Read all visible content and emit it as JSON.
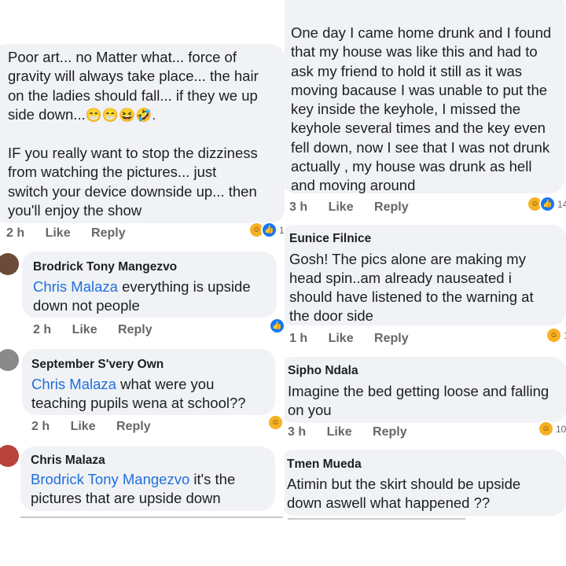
{
  "left": {
    "top_comment": {
      "lines": [
        "Poor  art... no Matter what... force of",
        "gravity will always take place... the hair",
        "on the ladies should  fall... if they we up",
        "side down...",
        "",
        "IF you really  want to  stop the dizziness",
        "from watching  the pictures... just",
        "switch your  device  downside up... then",
        "you'll  enjoy  the show"
      ],
      "emojis": "😁😁😆🤣.",
      "time": "2 h",
      "like": "Like",
      "reply": "Reply",
      "reaction_count": "1"
    },
    "comments": [
      {
        "name": "Brodrick Tony Mangezvo",
        "mention": "Chris Malaza",
        "line1_rest": " everything is upside",
        "line2": "down not people",
        "time": "2 h",
        "like": "Like",
        "reply": "Reply"
      },
      {
        "name": "September S'very Own",
        "mention": "Chris Malaza",
        "line1_rest": " what were you",
        "line2": "teaching pupils wena at school??",
        "time": "2 h",
        "like": "Like",
        "reply": "Reply"
      },
      {
        "name": "Chris Malaza",
        "mention": "Brodrick Tony Mangezvo",
        "line1_rest": " it's the",
        "line2": "pictures that are upside down"
      }
    ]
  },
  "right": {
    "top_comment": {
      "lines": [
        "One day I came home drunk and I found",
        "that my house was like this and had to",
        "ask my friend to hold it still as it was",
        "moving bacause  I was unable to put the",
        "key inside the keyhole, I missed the",
        "keyhole several times and the key even",
        "fell down, now I see that I was not drunk",
        "actually , my house was drunk as hell",
        "and moving around"
      ],
      "time": "3 h",
      "like": "Like",
      "reply": "Reply",
      "reaction_count": "14"
    },
    "comments": [
      {
        "name": "Eunice Filnice",
        "lines": [
          "Gosh! The pics alone are making my",
          "head spin..am already nauseated i",
          "should have listened to the warning at",
          "the door side"
        ],
        "time": "1 h",
        "like": "Like",
        "reply": "Reply",
        "reaction_count": "1"
      },
      {
        "name": "Sipho Ndala",
        "lines": [
          "Imagine the bed getting loose and falling",
          "on you"
        ],
        "time": "3 h",
        "like": "Like",
        "reply": "Reply",
        "reaction_count": "10"
      },
      {
        "name": "Tmen Mueda",
        "lines": [
          "Atimin but the skirt should be upside",
          "down aswell what happened ??"
        ]
      }
    ]
  },
  "colors": {
    "bubble": "#f0f2f5",
    "mention": "#216fdb",
    "meta": "#65676b",
    "like_reaction": "#1877f2",
    "haha_reaction": "#f7b125"
  },
  "icons": [
    "haha-reaction-icon",
    "like-reaction-icon",
    "avatar"
  ]
}
